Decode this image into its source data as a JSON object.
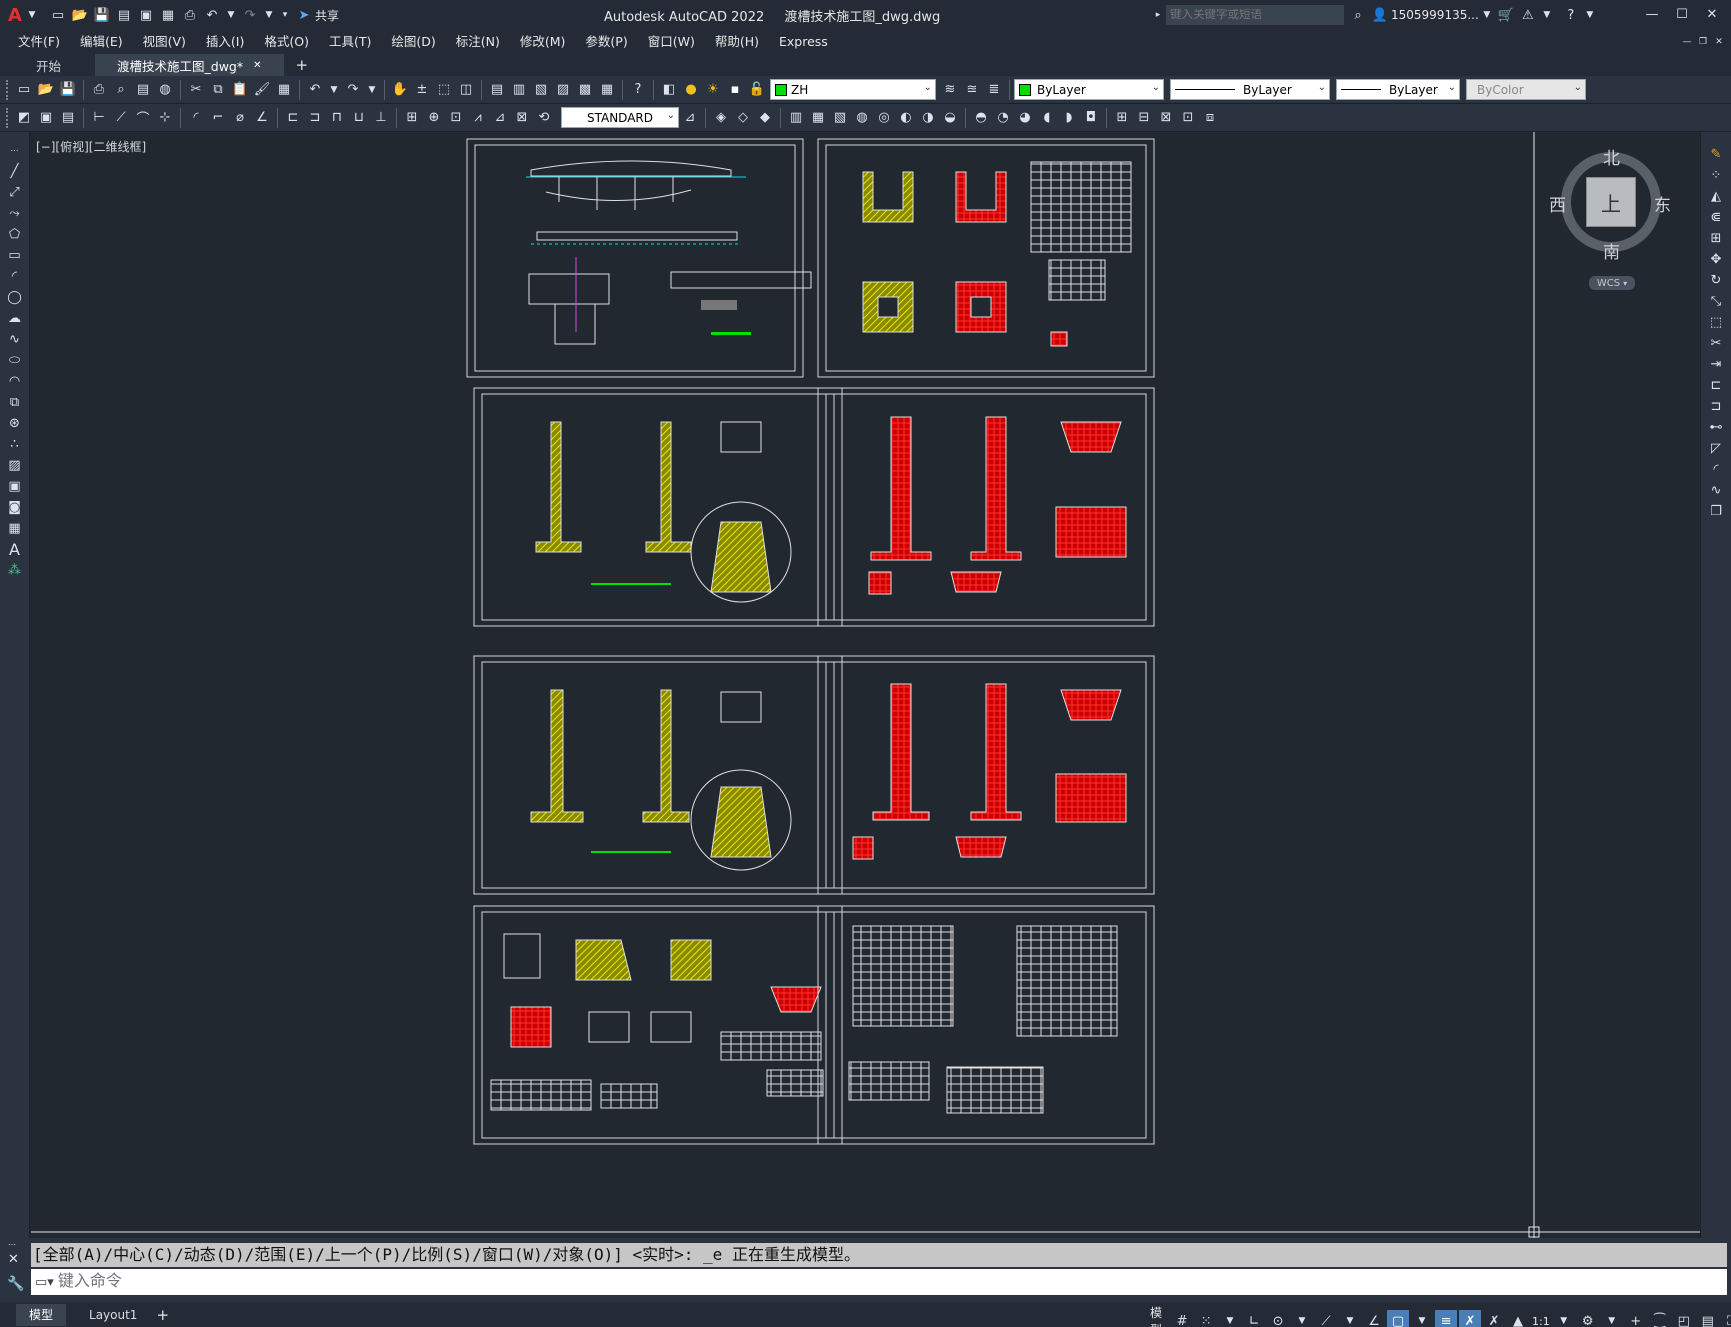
{
  "app": {
    "title": "Autodesk AutoCAD 2022",
    "doc_title": "渡槽技术施工图_dwg.dwg",
    "share_label": "共享",
    "search_placeholder": "键入关键字或短语",
    "user": "1505999135..."
  },
  "menu": [
    "文件(F)",
    "编辑(E)",
    "视图(V)",
    "插入(I)",
    "格式(O)",
    "工具(T)",
    "绘图(D)",
    "标注(N)",
    "修改(M)",
    "参数(P)",
    "窗口(W)",
    "帮助(H)",
    "Express"
  ],
  "tabs": {
    "start": "开始",
    "doc": "渡槽技术施工图_dwg*",
    "add": "+"
  },
  "toolbar": {
    "layer": "ZH",
    "color": "ByLayer",
    "linetype": "ByLayer",
    "lineweight": "ByLayer",
    "plotstyle": "ByColor",
    "textstyle": "STANDARD"
  },
  "viewport": {
    "label": "[−][俯视][二维线框]"
  },
  "viewcube": {
    "north": "北",
    "south": "南",
    "east": "东",
    "west": "西",
    "top": "上",
    "wcs": "WCS"
  },
  "command": {
    "history": "[全部(A)/中心(C)/动态(D)/范围(E)/上一个(P)/比例(S)/窗口(W)/对象(O)] <实时>: _e 正在重生成模型。",
    "placeholder": "键入命令"
  },
  "status": {
    "tab_model": "模型",
    "tab_layout": "Layout1",
    "add": "+",
    "model_label": "模型",
    "scale": "1:1"
  },
  "colors": {
    "accent": "#4a7fb5",
    "background": "#212830",
    "red_layer": "#e01010",
    "yellow_hatch": "#d6d600",
    "cyan_dim": "#00e0e0"
  }
}
